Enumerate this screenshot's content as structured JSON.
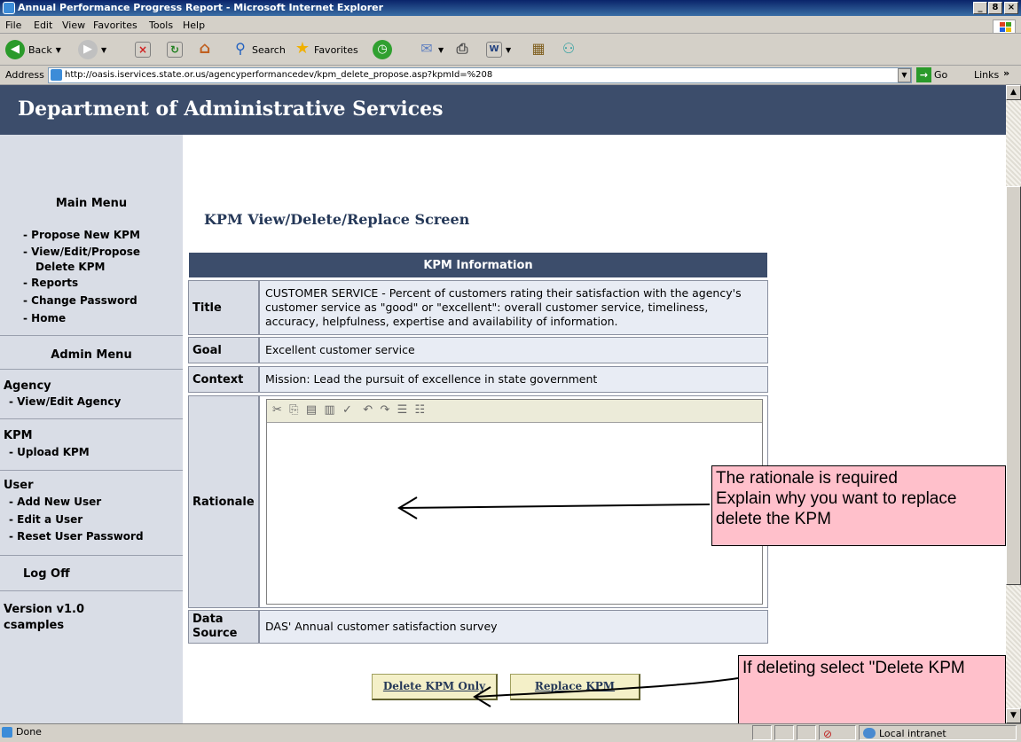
{
  "window": {
    "title": "Annual Performance Progress Report - Microsoft Internet Explorer",
    "min": "_",
    "max": "8",
    "close": "×"
  },
  "menu": [
    "File",
    "Edit",
    "View",
    "Favorites",
    "Tools",
    "Help"
  ],
  "toolbar": {
    "back": "Back",
    "search": "Search",
    "favorites": "Favorites"
  },
  "address": {
    "label": "Address",
    "url": "http://oasis.iservices.state.or.us/agencyperformancedev/kpm_delete_propose.asp?kpmId=%208",
    "go": "Go",
    "links": "Links"
  },
  "banner": "Department of Administrative Services",
  "sidebar": {
    "main_menu": "Main Menu",
    "main_items": [
      "- Propose New KPM",
      "- View/Edit/Propose",
      "Delete KPM",
      "- Reports",
      "- Change Password",
      "- Home"
    ],
    "admin_menu": "Admin Menu",
    "agency": "Agency",
    "agency_items": [
      "- View/Edit Agency"
    ],
    "kpm": "KPM",
    "kpm_items": [
      "- Upload KPM"
    ],
    "user": "User",
    "user_items": [
      "- Add New User",
      "- Edit a User",
      "- Reset User Password"
    ],
    "logoff": "Log Off",
    "version": "Version v1.0",
    "username": "csamples"
  },
  "page_heading": "KPM View/Delete/Replace Screen",
  "kpm_info": {
    "header": "KPM Information",
    "title_label": "Title",
    "title_value": "CUSTOMER SERVICE - Percent of customers rating their satisfaction with the agency's customer service as \"good\" or \"excellent\": overall customer service, timeliness, accuracy, helpfulness, expertise and availability of information.",
    "goal_label": "Goal",
    "goal_value": "Excellent customer service",
    "context_label": "Context",
    "context_value": "Mission: Lead the pursuit of excellence in state government",
    "rationale_label": "Rationale",
    "rationale_value": "",
    "source_label": "Data\nSource",
    "source_value": "DAS' Annual customer satisfaction survey"
  },
  "buttons": {
    "delete": "Delete KPM Only",
    "replace": "Replace KPM"
  },
  "callouts": {
    "rationale": [
      "The rationale is required",
      "Explain why you want to replace",
      "delete the KPM"
    ],
    "delete": "If deleting select \"Delete KPM"
  },
  "status": {
    "left": "Done",
    "zone": "Local intranet"
  }
}
